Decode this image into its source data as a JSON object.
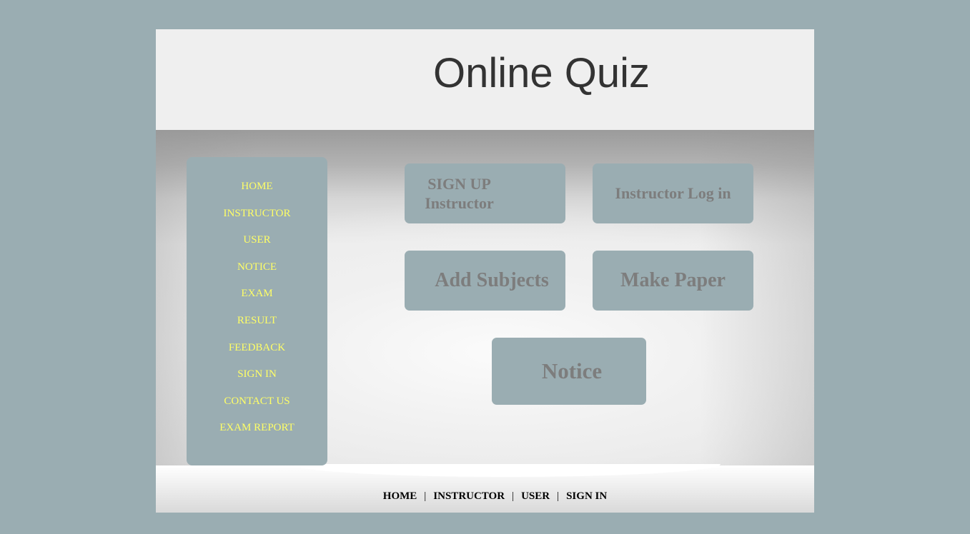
{
  "site": {
    "title": "Online Quiz"
  },
  "sidebar": {
    "items": [
      {
        "label": "HOME"
      },
      {
        "label": "INSTRUCTOR"
      },
      {
        "label": "USER"
      },
      {
        "label": "NOTICE"
      },
      {
        "label": "EXAM"
      },
      {
        "label": "RESULT"
      },
      {
        "label": "FEEDBACK"
      },
      {
        "label": "SIGN IN"
      },
      {
        "label": "CONTACT US"
      },
      {
        "label": "EXAM REPORT"
      }
    ]
  },
  "tiles": {
    "signup_line1": "SIGN UP",
    "signup_line2": "Instructor",
    "instructor_login": "Instructor Log in",
    "add_subjects": "Add Subjects",
    "make_paper": "Make Paper",
    "notice": "Notice"
  },
  "footer": {
    "links": [
      {
        "label": "HOME"
      },
      {
        "label": "INSTRUCTOR"
      },
      {
        "label": "USER"
      },
      {
        "label": "SIGN IN"
      }
    ],
    "separator": "|"
  },
  "colors": {
    "background": "#9aadb2",
    "panel": "#efefef",
    "sidebar_link": "#ffff66",
    "tile_text": "#7d7d7d",
    "title_text": "#333333"
  }
}
